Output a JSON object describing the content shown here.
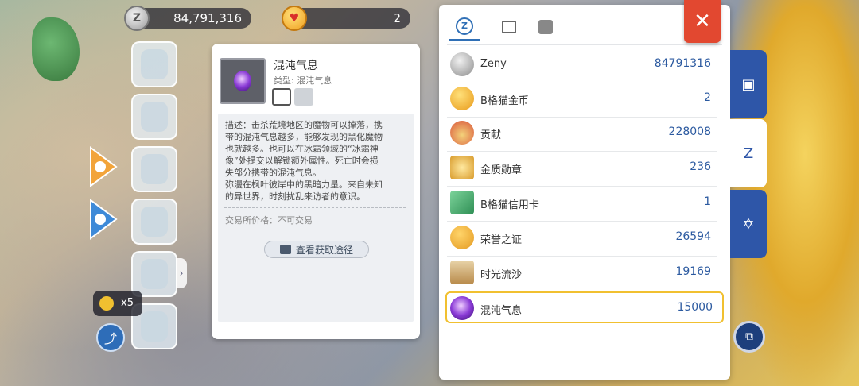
{
  "top_bar": {
    "zeny_value": "84,791,316",
    "cat_coin_value": "2"
  },
  "popup": {
    "count": "x5"
  },
  "detail": {
    "name": "混沌气息",
    "type": "类型: 混沌气息",
    "desc_lines": [
      "描述：击杀荒境地区的魔物可以掉落，携",
      "带的混沌气息越多，能够发现的黑化魔物",
      "也就越多。也可以在冰霜领域的“冰霜神",
      "像”处提交以解锁额外属性。死亡时会损",
      "失部分携带的混沌气息。",
      "弥漫在枫叶彼岸中的黑暗力量。来自未知",
      "的异世界，时刻扰乱来访者的意识。"
    ],
    "price": "交易所价格：不可交易",
    "source_button": "查看获取途径"
  },
  "panel": {
    "rows": [
      {
        "name": "Zeny",
        "value": "84791316",
        "icon": "zeny-coin-icon",
        "color": "#bdbdbd"
      },
      {
        "name": "B格猫金币",
        "value": "2",
        "icon": "cat-coin-icon",
        "color": "#f2b233"
      },
      {
        "name": "贡献",
        "value": "228008",
        "icon": "contribution-medal-icon",
        "color": "#d9533a"
      },
      {
        "name": "金质勋章",
        "value": "236",
        "icon": "gold-medal-icon",
        "color": "#e8b43a"
      },
      {
        "name": "B格猫信用卡",
        "value": "1",
        "icon": "credit-card-icon",
        "color": "#46a765"
      },
      {
        "name": "荣誉之证",
        "value": "26594",
        "icon": "honor-coin-icon",
        "color": "#f0b03b"
      },
      {
        "name": "时光流沙",
        "value": "19169",
        "icon": "hourglass-icon",
        "color": "#c9a46b"
      },
      {
        "name": "混沌气息",
        "value": "15000",
        "icon": "chaos-orb-icon",
        "color": "#7b39c8"
      }
    ]
  },
  "glyphs": {
    "close": "✕",
    "share": "⤴",
    "chevron": "›",
    "z": "Z",
    "backpack": "▣",
    "bag": "Z",
    "hex": "✡",
    "corner": "⧉"
  }
}
